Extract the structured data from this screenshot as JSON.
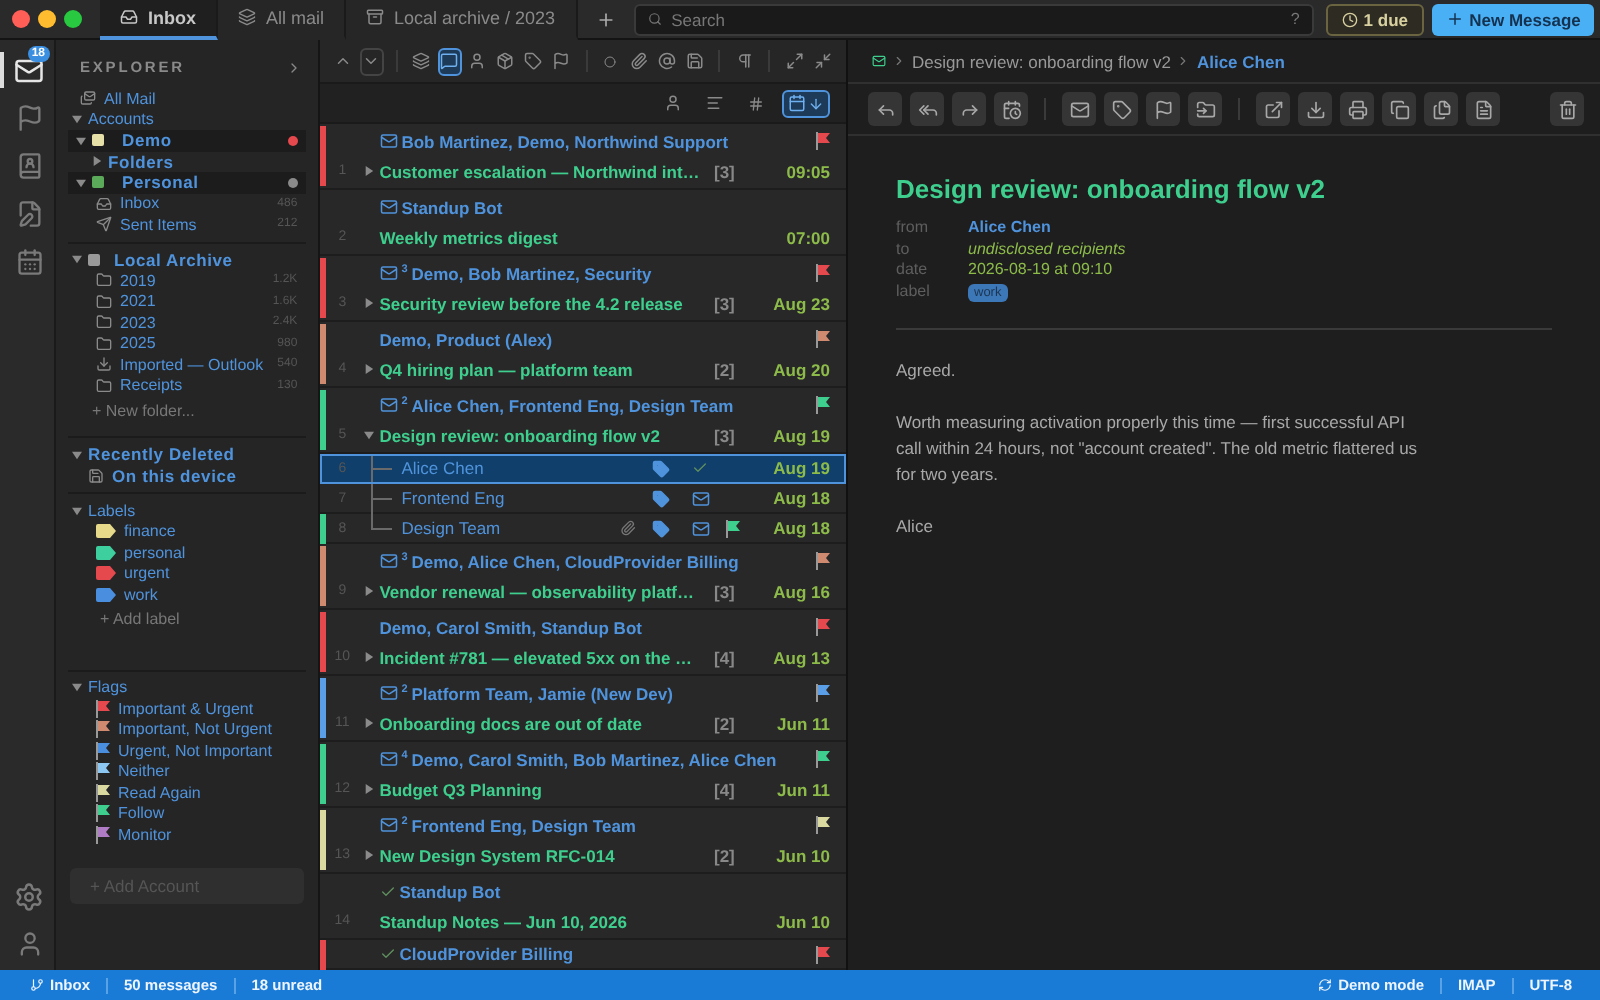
{
  "window": {
    "tabs": [
      {
        "kind": "inbox",
        "label": "Inbox",
        "selected": true
      },
      {
        "kind": "all",
        "label": "All mail",
        "selected": false
      },
      {
        "kind": "archive",
        "label": "Local archive / 2023",
        "selected": false
      }
    ]
  },
  "search": {
    "placeholder": "Search",
    "help": "?"
  },
  "due_button": "1 due",
  "new_message_button": "New Message",
  "activity_bar": [
    {
      "kind": "mail",
      "badge": "18",
      "selected": true
    },
    {
      "kind": "flags",
      "selected": false
    },
    {
      "kind": "contacts",
      "selected": false
    },
    {
      "kind": "notes",
      "selected": false
    },
    {
      "kind": "calendar",
      "selected": false
    }
  ],
  "sidebar": {
    "title": "EXPLORER",
    "sections": [
      {
        "kind": "link",
        "title": "All Mail"
      },
      {
        "kind": "accounts",
        "title": "Accounts",
        "expanded": true,
        "items": [
          {
            "label": "Demo",
            "color": "#e6e0a6",
            "unread": true,
            "expanded": true,
            "children": [
              {
                "kind": "group",
                "label": "Folders",
                "expanded": false
              }
            ]
          },
          {
            "label": "Personal",
            "color": "#5aaa5a",
            "unread": false,
            "expanded": true,
            "children": [
              {
                "kind": "inbox",
                "label": "Inbox",
                "count": "486"
              },
              {
                "kind": "sent",
                "label": "Sent Items",
                "count": "212"
              }
            ]
          }
        ]
      },
      {
        "kind": "archive",
        "title": "Local Archive",
        "expanded": true,
        "items": [
          {
            "kind": "folder",
            "label": "2019",
            "count": "1.2K"
          },
          {
            "kind": "folder",
            "label": "2021",
            "count": "1.6K"
          },
          {
            "kind": "folder",
            "label": "2023",
            "count": "2.4K"
          },
          {
            "kind": "folder",
            "label": "2025",
            "count": "980"
          },
          {
            "kind": "import",
            "label": "Imported — Outlook",
            "count": "540"
          },
          {
            "kind": "folder",
            "label": "Receipts",
            "count": "130"
          }
        ],
        "add": "+ New folder..."
      },
      {
        "kind": "tree",
        "title": "Recently Deleted",
        "expanded": true,
        "items": [
          {
            "kind": "device",
            "label": "On this device"
          }
        ]
      },
      {
        "kind": "labels",
        "title": "Labels",
        "expanded": true,
        "items": [
          {
            "label": "finance",
            "color": "#e6d98a"
          },
          {
            "label": "personal",
            "color": "#3ecf9e"
          },
          {
            "label": "urgent",
            "color": "#e5484d"
          },
          {
            "label": "work",
            "color": "#4a8fdf"
          }
        ],
        "add": "+ Add label"
      },
      {
        "kind": "flags",
        "title": "Flags",
        "expanded": true,
        "items": [
          {
            "label": "Important & Urgent",
            "color": "#e5484d"
          },
          {
            "label": "Important, Not Urgent",
            "color": "#d08a70"
          },
          {
            "label": "Urgent, Not Important",
            "color": "#4a8fdf"
          },
          {
            "label": "Neither",
            "color": "#8cc8f2"
          },
          {
            "label": "Read Again",
            "color": "#d9d9a0"
          },
          {
            "label": "Follow",
            "color": "#3ecf8e"
          },
          {
            "label": "Monitor",
            "color": "#b07cc6"
          }
        ]
      }
    ],
    "add_account": {
      "label": "+ Add Account",
      "disabled": true
    }
  },
  "list_toolbar": [
    {
      "selected": false
    },
    {
      "selected": false
    },
    {
      "selected": false
    },
    {
      "selected": true
    },
    {
      "selected": false
    },
    {
      "selected": false
    },
    {
      "selected": false
    },
    {
      "selected": false
    },
    {
      "selected": false
    },
    {
      "selected": false
    },
    {
      "selected": false
    },
    {
      "selected": false
    },
    {
      "selected": false
    },
    {
      "selected": false
    },
    {
      "selected": false
    }
  ],
  "list_columns": [
    {
      "selected": false
    },
    {
      "selected": false
    },
    {
      "selected": false
    },
    {
      "selected": true
    }
  ],
  "messages": [
    {
      "kind": "thread",
      "number": "1",
      "sender": "Bob Martinez, Demo, Northwind Support",
      "unread": true,
      "subject": "Customer escalation — Northwind int…",
      "replies": "[3]",
      "date": "09:05",
      "color": "#e5484d",
      "expanded": false,
      "selected": false
    },
    {
      "kind": "thread",
      "number": "2",
      "sender": "Standup Bot",
      "unread": true,
      "subject": "Weekly metrics digest",
      "date": "07:00",
      "selected": false
    },
    {
      "kind": "thread",
      "number": "3",
      "sender": "Demo, Bob Martinez, Security",
      "unread": true,
      "thread_count": "3",
      "subject": "Security review before the 4.2 release",
      "replies": "[3]",
      "date": "Aug 23",
      "color": "#e5484d",
      "expanded": false,
      "selected": false
    },
    {
      "kind": "thread",
      "number": "4",
      "sender": "Demo, Product (Alex)",
      "unread": false,
      "answered": false,
      "subject": "Q4 hiring plan — platform team",
      "replies": "[2]",
      "date": "Aug 20",
      "color": "#d08a70",
      "expanded": false,
      "selected": false
    },
    {
      "kind": "thread",
      "number": "5",
      "sender": "Alice Chen, Frontend Eng, Design Team",
      "unread": true,
      "thread_count": "2",
      "subject": "Design review: onboarding flow v2",
      "replies": "[3]",
      "date": "Aug 19",
      "color": "#3ecf8e",
      "expanded": true,
      "selected": false
    },
    {
      "kind": "reply",
      "number": "6",
      "sender": "Alice Chen",
      "labeled": true,
      "unread": false,
      "answered": true,
      "date": "Aug 19",
      "selected": true
    },
    {
      "kind": "reply",
      "number": "7",
      "sender": "Frontend Eng",
      "labeled": true,
      "unread": true,
      "date": "Aug 18",
      "selected": false
    },
    {
      "kind": "reply",
      "number": "8",
      "sender": "Design Team",
      "labeled": true,
      "attachment": true,
      "unread": true,
      "date": "Aug 18",
      "color": "#3ecf8e",
      "selected": false
    },
    {
      "kind": "thread",
      "number": "9",
      "sender": "Demo, Alice Chen, CloudProvider Billing",
      "unread": true,
      "thread_count": "3",
      "subject": "Vendor renewal — observability platf…",
      "replies": "[3]",
      "date": "Aug 16",
      "color": "#d08a70",
      "expanded": false,
      "selected": false
    },
    {
      "kind": "thread",
      "number": "10",
      "sender": "Demo, Carol Smith, Standup Bot",
      "unread": false,
      "answered": false,
      "subject": "Incident #781 — elevated 5xx on the …",
      "replies": "[4]",
      "date": "Aug 13",
      "color": "#e5484d",
      "expanded": false,
      "selected": false
    },
    {
      "kind": "thread",
      "number": "11",
      "sender": "Platform Team, Jamie (New Dev)",
      "unread": true,
      "thread_count": "2",
      "subject": "Onboarding docs are out of date",
      "replies": "[2]",
      "date": "Jun 11",
      "color": "#5a9ee8",
      "expanded": false,
      "selected": false
    },
    {
      "kind": "thread",
      "number": "12",
      "sender": "Demo, Carol Smith, Bob Martinez, Alice Chen",
      "unread": true,
      "thread_count": "4",
      "subject": "Budget Q3 Planning",
      "replies": "[4]",
      "date": "Jun 11",
      "color": "#3ecf8e",
      "expanded": false,
      "selected": false
    },
    {
      "kind": "thread",
      "number": "13",
      "sender": "Frontend Eng, Design Team",
      "unread": true,
      "thread_count": "2",
      "subject": "New Design System RFC-014",
      "replies": "[2]",
      "date": "Jun 10",
      "color": "#d9d9a0",
      "expanded": false,
      "selected": false
    },
    {
      "kind": "thread",
      "number": "14",
      "sender": "Standup Bot",
      "unread": false,
      "answered": true,
      "subject": "Standup Notes — Jun 10, 2026",
      "date": "Jun 10",
      "selected": false
    },
    {
      "kind": "thread",
      "sender": "CloudProvider Billing",
      "unread": false,
      "answered": true,
      "color": "#e5484d",
      "selected": false
    }
  ],
  "reader": {
    "breadcrumb": [
      "Design review: onboarding flow v2",
      "Alice Chen"
    ],
    "title": "Design review: onboarding flow v2",
    "meta": [
      {
        "kind": "contact",
        "label": "from",
        "value": "Alice Chen"
      },
      {
        "kind": "recipients",
        "label": "to",
        "value": "undisclosed recipients"
      },
      {
        "kind": "date",
        "label": "date",
        "value": "2026-08-19 at 09:10"
      },
      {
        "kind": "tag",
        "label": "label",
        "value": "work"
      }
    ],
    "body": [
      "Agreed.",
      "Worth measuring activation properly this time — first successful API call within 24 hours, not \"account created\". The old metric flattered us for two years.",
      "Alice"
    ]
  },
  "status_bar": {
    "left": [
      "Inbox",
      "50 messages",
      "18 unread"
    ],
    "right": [
      "Demo mode",
      "IMAP",
      "UTF-8"
    ]
  }
}
